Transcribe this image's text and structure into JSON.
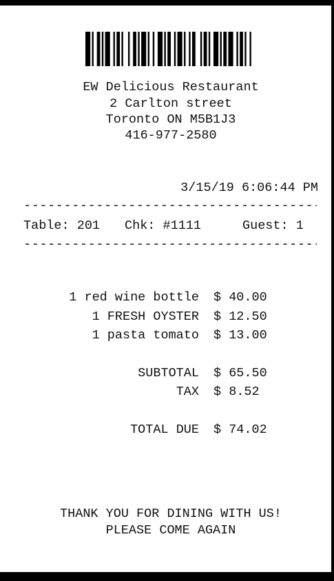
{
  "restaurant": {
    "name": "EW Delicious Restaurant",
    "address_line1": "2 Carlton street",
    "address_line2": "Toronto ON M5B1J3",
    "phone": "416-977-2580"
  },
  "datetime": "3/15/19 6:06:44 PM",
  "separator": "-----------------------------------------------",
  "check_info": {
    "table": "Table: 201",
    "check": "Chk: #1111",
    "guest": "Guest: 1"
  },
  "items": [
    {
      "description": "1 red wine bottle",
      "price": "$ 40.00"
    },
    {
      "description": "1 FRESH OYSTER",
      "price": "$ 12.50"
    },
    {
      "description": "1 pasta tomato",
      "price": "$ 13.00"
    }
  ],
  "totals": {
    "subtotal_label": "SUBTOTAL",
    "subtotal_value": "$ 65.50",
    "tax_label": "TAX",
    "tax_value": "$ 8.52",
    "total_label": "TOTAL DUE",
    "total_value": "$ 74.02"
  },
  "footer": {
    "line1": "THANK YOU FOR DINING WITH US!",
    "line2": "PLEASE COME AGAIN"
  }
}
